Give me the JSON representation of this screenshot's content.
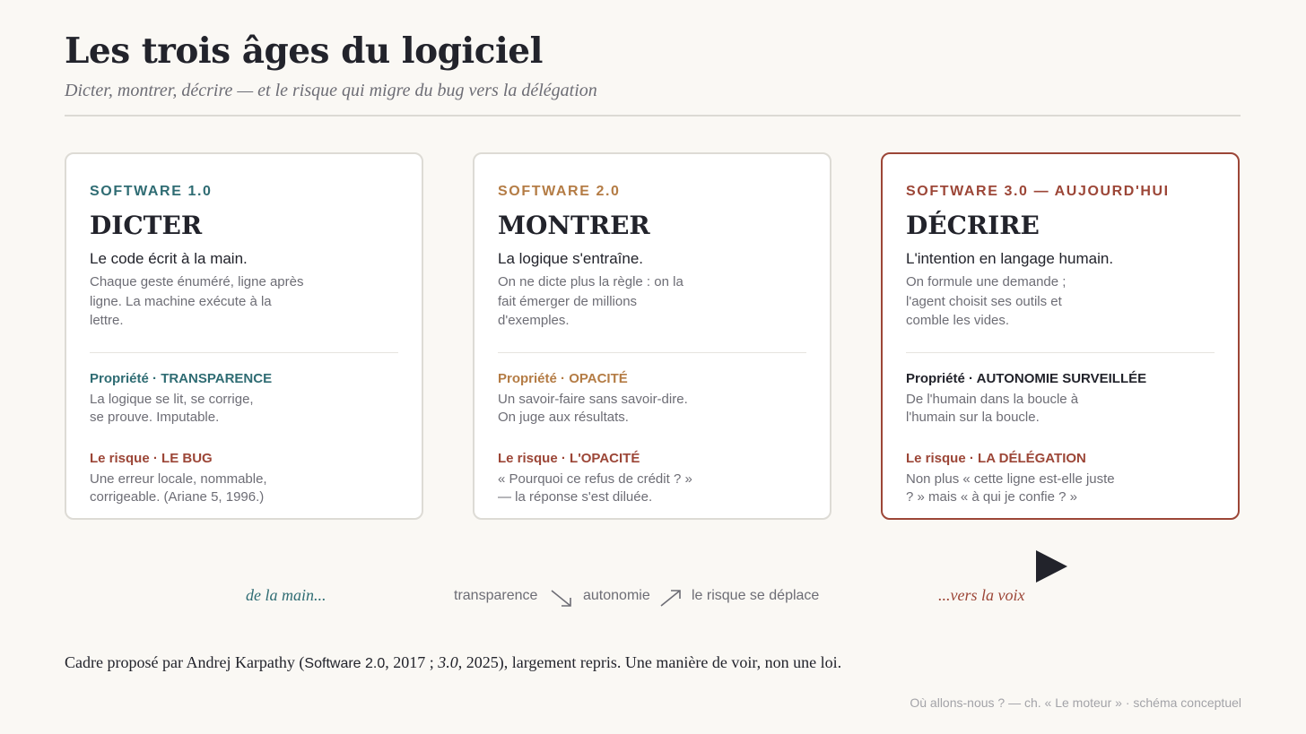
{
  "header": {
    "title": "Les trois âges du logiciel",
    "subtitle": "Dicter, montrer, décrire — et le risque qui migre du bug vers la délégation"
  },
  "cards": [
    {
      "eyebrow": "SOFTWARE 1.0",
      "heading": "DICTER",
      "lead": "Le code écrit à la main.",
      "description": "Chaque geste énuméré, ligne après ligne. La machine exécute à la lettre.",
      "property_prefix": "Propriété · ",
      "property_name": "TRANSPARENCE",
      "property_text": "La logique se lit, se corrige, se prouve. Imputable.",
      "risk_prefix": "Le risque · ",
      "risk_name": "LE BUG",
      "risk_text": "Une erreur locale, nommable, corrigeable. (Ariane 5, 1996.)"
    },
    {
      "eyebrow": "SOFTWARE 2.0",
      "heading": "MONTRER",
      "lead": "La logique s'entraîne.",
      "description": "On ne dicte plus la règle : on la fait émerger de millions d'exemples.",
      "property_prefix": "Propriété · ",
      "property_name": "OPACITÉ",
      "property_text": "Un savoir-faire sans savoir-dire. On juge aux résultats.",
      "risk_prefix": "Le risque · ",
      "risk_name": "L'OPACITÉ",
      "risk_text": "« Pourquoi ce refus de crédit ? » — la réponse s'est diluée."
    },
    {
      "eyebrow": "SOFTWARE 3.0 — AUJOURD'HUI",
      "heading": "DÉCRIRE",
      "lead": "L'intention en langage humain.",
      "description": "On formule une demande ; l'agent choisit ses outils et comble les vides.",
      "property_prefix": "Propriété · ",
      "property_name": "AUTONOMIE SURVEILLÉE",
      "property_text": "De l'humain dans la boucle à l'humain sur la boucle.",
      "risk_prefix": "Le risque · ",
      "risk_name": "LA DÉLÉGATION",
      "risk_text": "Non plus « cette ligne est-elle juste ? » mais « à qui je confie ? »"
    }
  ],
  "flow": {
    "start": "de la main...",
    "word1": "transparence",
    "word2": "autonomie",
    "word3": "le risque se déplace",
    "end": "...vers la voix"
  },
  "footnote": {
    "part1": "Cadre proposé par Andrej Karpathy (",
    "part2": "Software 2.0",
    "part3": ", 2017 ; ",
    "part4": "3.0",
    "part5": ", 2025), largement repris. Une manière de voir, non une loi."
  },
  "credit": "Où allons-nous ? — ch. « Le moteur » · schéma conceptuel",
  "colors": {
    "teal": "#2f6c73",
    "ochre": "#b47c45",
    "brick": "#9c4637",
    "ink": "#22232b",
    "background": "#faf8f4"
  },
  "icons": [
    "play-icon",
    "arrow-down-right-icon",
    "arrow-up-right-icon"
  ]
}
